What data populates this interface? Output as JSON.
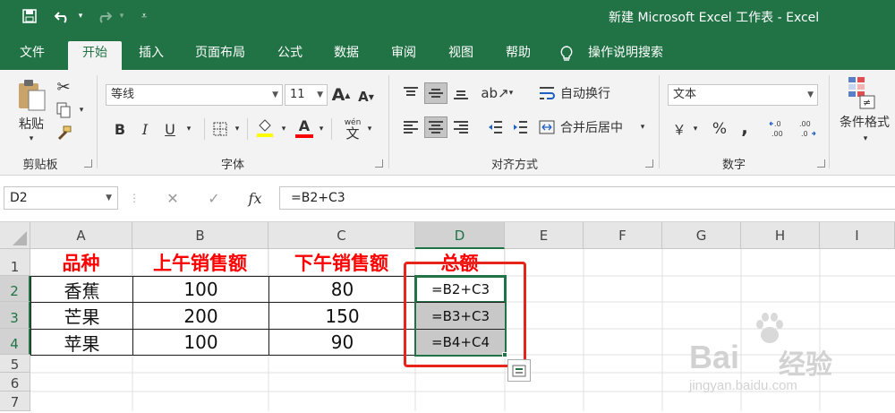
{
  "window": {
    "title": "新建 Microsoft Excel 工作表 - Excel"
  },
  "tabs": [
    "文件",
    "开始",
    "插入",
    "页面布局",
    "公式",
    "数据",
    "审阅",
    "视图",
    "帮助"
  ],
  "tell_me": "操作说明搜索",
  "ribbon": {
    "clipboard": {
      "paste": "粘贴",
      "label": "剪贴板"
    },
    "font": {
      "name": "等线",
      "size": "11",
      "grow": "A",
      "shrink": "A",
      "bold": "B",
      "italic": "I",
      "underline": "U",
      "wen": "wén",
      "wen_char": "文",
      "label": "字体"
    },
    "align": {
      "wrap": "自动换行",
      "merge": "合并后居中",
      "label": "对齐方式"
    },
    "number": {
      "format": "文本",
      "currency": "￥",
      "percent": "%",
      "comma": ",",
      "inc": "←.0\n.00",
      "label": "数字"
    },
    "styles": {
      "cond": "条件格式"
    }
  },
  "formula_bar": {
    "name_box": "D2",
    "formula": "=B2+C3",
    "fx": "fx"
  },
  "columns": [
    "A",
    "B",
    "C",
    "D",
    "E",
    "F",
    "G",
    "H",
    "I"
  ],
  "rows": [
    "1",
    "2",
    "3",
    "4",
    "5",
    "6",
    "7"
  ],
  "table": {
    "headers": [
      "品种",
      "上午销售额",
      "下午销售额",
      "总额"
    ],
    "rows": [
      [
        "香蕉",
        "100",
        "80",
        "=B2+C3"
      ],
      [
        "芒果",
        "200",
        "150",
        "=B3+C3"
      ],
      [
        "苹果",
        "100",
        "90",
        "=B4+C4"
      ]
    ]
  },
  "watermark": {
    "brand": "Bai",
    "brand2": "经验",
    "url": "jingyan.baidu.com"
  },
  "colors": {
    "excel_green": "#217346",
    "header_red": "#ff0000",
    "highlight_box": "#e8231b",
    "selected_fill": "#c8c8c8"
  }
}
